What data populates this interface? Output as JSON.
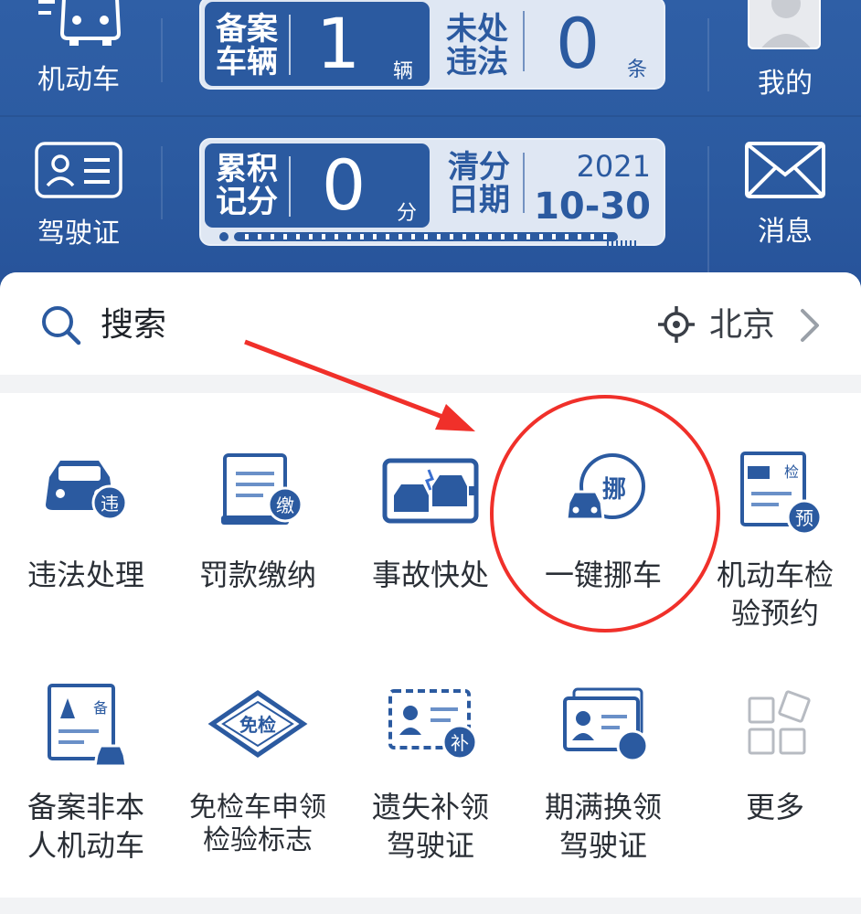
{
  "header": {
    "left_items": [
      {
        "label": "机动车",
        "icon": "car-outline-icon"
      },
      {
        "label": "驾驶证",
        "icon": "license-card-icon"
      }
    ],
    "card_vehicle": {
      "title1": "备案\n车辆",
      "count": "1",
      "count_unit": "辆",
      "title2": "未处\n违法",
      "violations": "0",
      "violations_unit": "条"
    },
    "card_points": {
      "title1": "累积\n记分",
      "points": "0",
      "points_unit": "分",
      "title2": "清分\n日期",
      "year": "2021",
      "month_day": "10-30"
    },
    "right_items": [
      {
        "label": "我的",
        "icon": "avatar-icon"
      },
      {
        "label": "消息",
        "icon": "mail-icon"
      }
    ]
  },
  "search": {
    "placeholder": "搜索",
    "city": "北京"
  },
  "services": [
    {
      "label": "违法处理",
      "icon": "violation-car-icon",
      "badge": "违"
    },
    {
      "label": "罚款缴纳",
      "icon": "fine-scroll-icon",
      "badge": "缴"
    },
    {
      "label": "事故快处",
      "icon": "accident-icon"
    },
    {
      "label": "一键挪车",
      "icon": "move-car-icon",
      "badge": "挪"
    },
    {
      "label": "机动车检\n验预约",
      "icon": "inspection-booking-icon",
      "badge": "预",
      "tag": "检"
    },
    {
      "label": "备案非本\n人机动车",
      "icon": "register-vehicle-icon",
      "tag": "备"
    },
    {
      "label": "免检车申领\n检验标志",
      "icon": "exempt-badge-icon",
      "tag": "免检"
    },
    {
      "label": "遗失补领\n驾驶证",
      "icon": "reissue-license-icon",
      "badge": "补"
    },
    {
      "label": "期满换领\n驾驶证",
      "icon": "renew-license-icon"
    },
    {
      "label": "更多",
      "icon": "more-grid-icon"
    }
  ],
  "colors": {
    "primary": "#2b5aa0",
    "accent": "#3a6fd0",
    "annotation": "#f0302a"
  }
}
